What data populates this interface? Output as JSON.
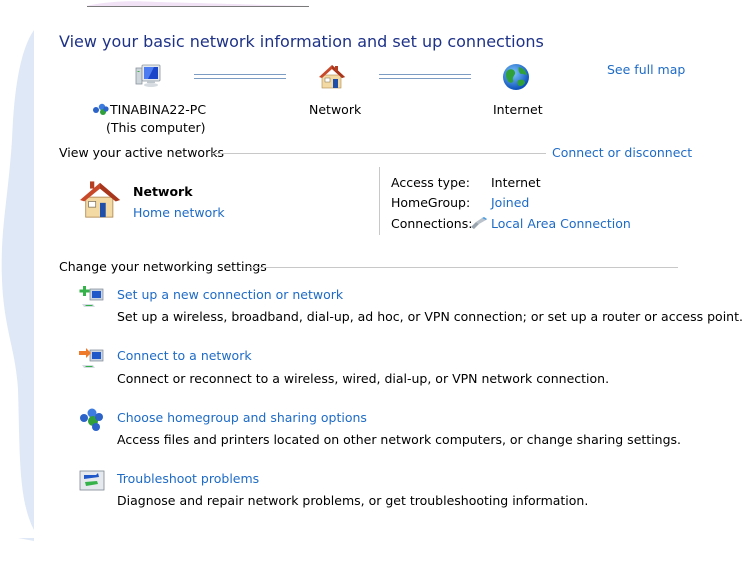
{
  "page": {
    "title": "View your basic network information and set up connections",
    "see_full_map": "See full map"
  },
  "map": {
    "computer": {
      "icon": "computer-icon",
      "name": "TINABINA22-PC",
      "sub": "(This computer)"
    },
    "network": {
      "icon": "house-icon",
      "name": "Network"
    },
    "internet": {
      "icon": "globe-icon",
      "name": "Internet"
    }
  },
  "active_networks": {
    "heading": "View your active networks",
    "connect_link": "Connect or disconnect",
    "network_name": "Network",
    "network_type": "Home network",
    "properties": [
      {
        "label": "Access type:",
        "value": "Internet",
        "is_link": false
      },
      {
        "label": "HomeGroup:",
        "value": "Joined",
        "is_link": true
      },
      {
        "label": "Connections:",
        "value": "Local Area Connection",
        "is_link": true,
        "icon": "ethernet-icon"
      }
    ]
  },
  "settings": {
    "heading": "Change your networking settings",
    "tasks": [
      {
        "icon": "new-connection-icon",
        "title": "Set up a new connection or network",
        "desc": "Set up a wireless, broadband, dial-up, ad hoc, or VPN connection; or set up a router or access point."
      },
      {
        "icon": "connect-network-icon",
        "title": "Connect to a network",
        "desc": "Connect or reconnect to a wireless, wired, dial-up, or VPN network connection."
      },
      {
        "icon": "homegroup-icon",
        "title": "Choose homegroup and sharing options",
        "desc": "Access files and printers located on other network computers, or change sharing settings."
      },
      {
        "icon": "troubleshoot-icon",
        "title": "Troubleshoot problems",
        "desc": "Diagnose and repair network problems, or get troubleshooting information."
      }
    ]
  },
  "colors": {
    "title": "#1e3287",
    "link": "#1e6bc6",
    "separator": "#c8c8c8",
    "left_decor": "#dfe8f6"
  }
}
